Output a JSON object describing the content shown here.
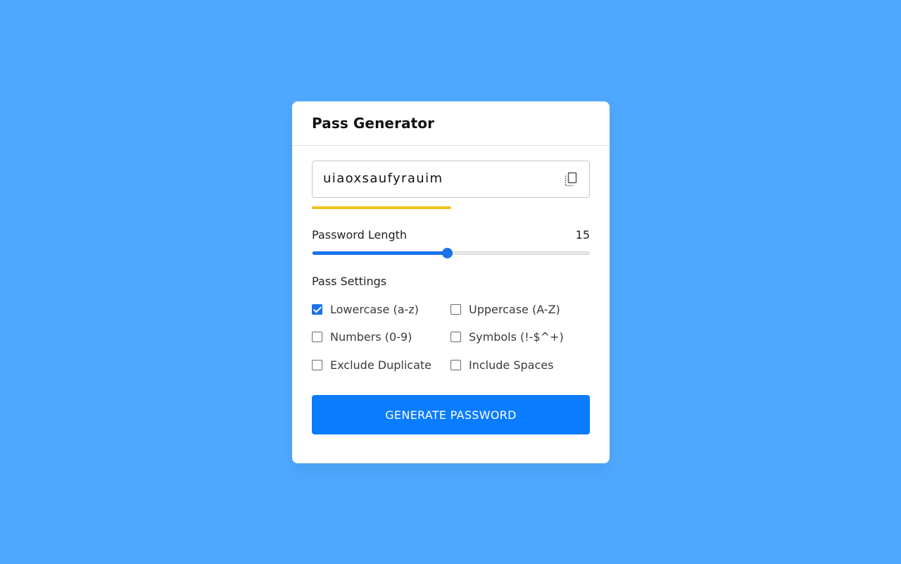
{
  "app": {
    "title": "Pass Generator"
  },
  "password": {
    "value": "uiaoxsaufyrauim",
    "copy_icon": "copy-icon",
    "strength_level": 0.5,
    "strength_color": "#f2c21b"
  },
  "length": {
    "label": "Password Length",
    "value": "15",
    "min": 1,
    "max": 30,
    "current": 15,
    "track_color": "#e9e9e9",
    "fill_color": "#1a73e8"
  },
  "settings": {
    "label": "Pass Settings",
    "options": [
      {
        "label": "Lowercase (a-z)",
        "checked": true
      },
      {
        "label": "Uppercase (A-Z)",
        "checked": false
      },
      {
        "label": "Numbers (0-9)",
        "checked": false
      },
      {
        "label": "Symbols (!-$^+)",
        "checked": false
      },
      {
        "label": "Exclude Duplicate",
        "checked": false
      },
      {
        "label": "Include Spaces",
        "checked": false
      }
    ]
  },
  "action": {
    "generate_label": "GENERATE PASSWORD",
    "button_color": "#0a7cff"
  },
  "colors": {
    "background": "#4fa8ff",
    "card": "#ffffff",
    "accent": "#1a73e8"
  }
}
